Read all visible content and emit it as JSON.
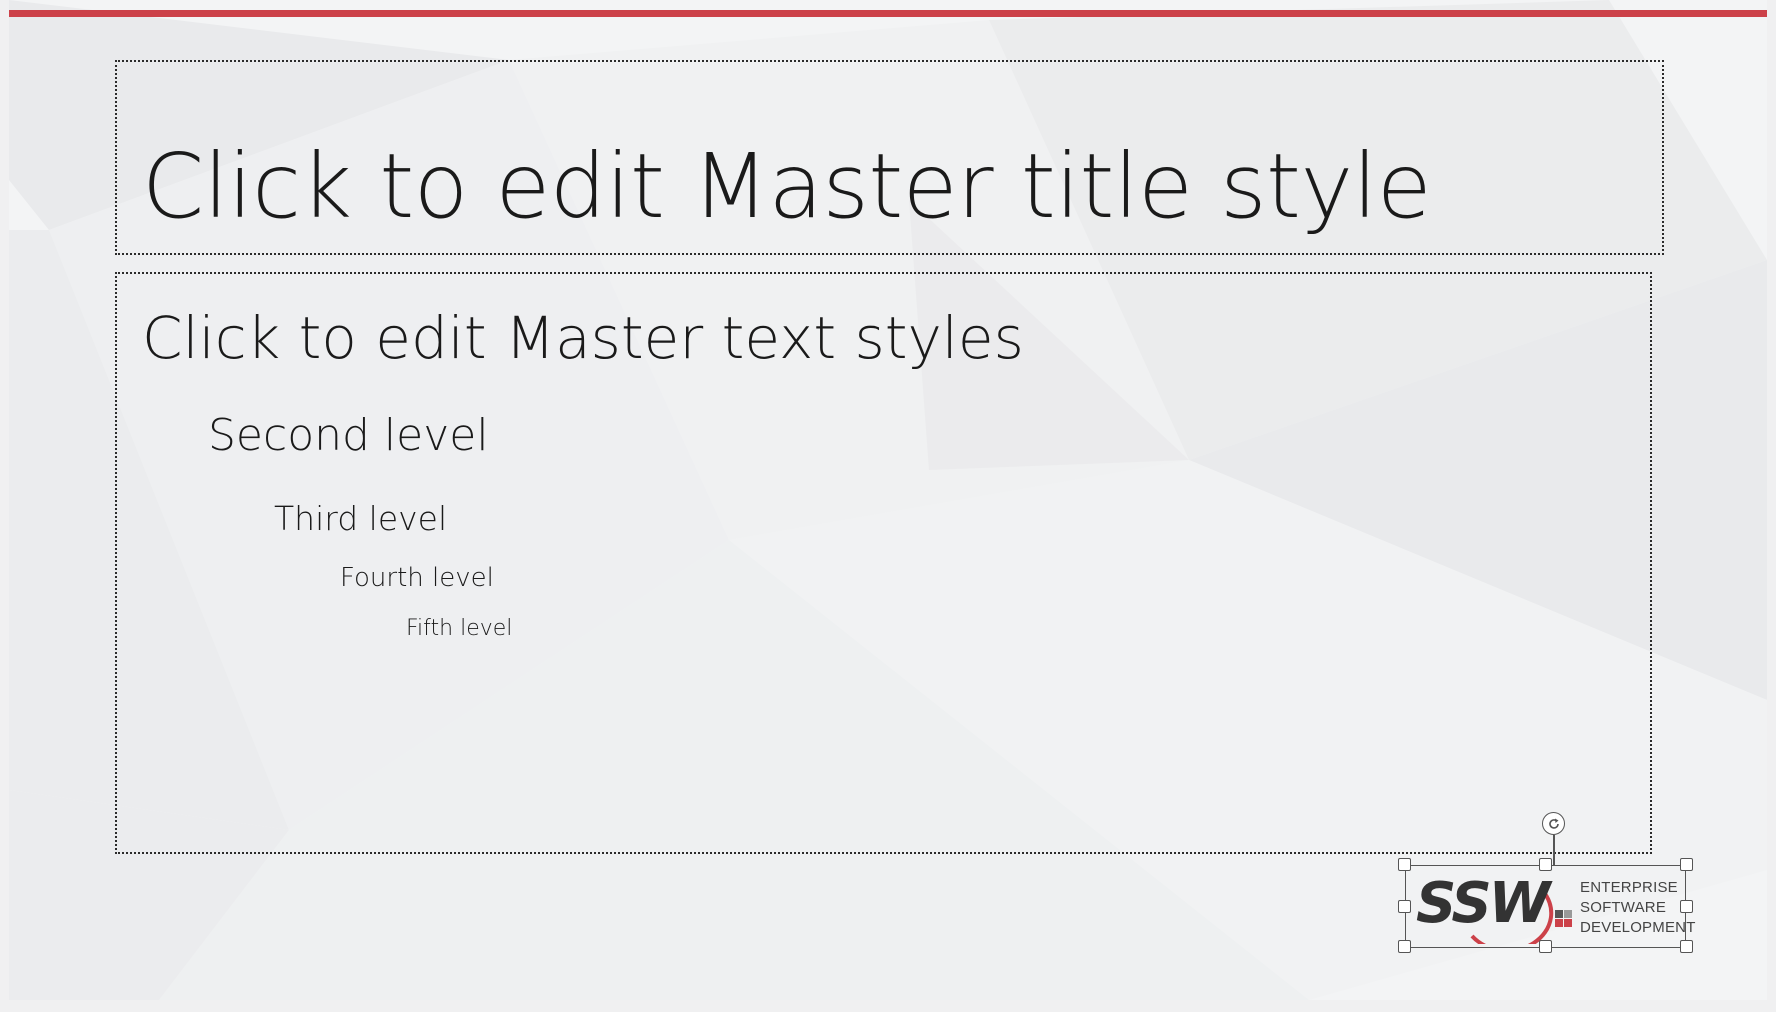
{
  "slide": {
    "accent_color": "#cc4149",
    "title": "Click to edit Master title style",
    "body_levels": [
      "Click to edit Master text styles",
      "Second level",
      "Third level",
      "Fourth level",
      "Fifth level"
    ]
  },
  "logo": {
    "name": "SSW",
    "tagline": [
      "ENTERPRISE",
      "SOFTWARE",
      "DEVELOPMENT"
    ],
    "selected": true,
    "rotate_icon": "rotate-icon"
  }
}
